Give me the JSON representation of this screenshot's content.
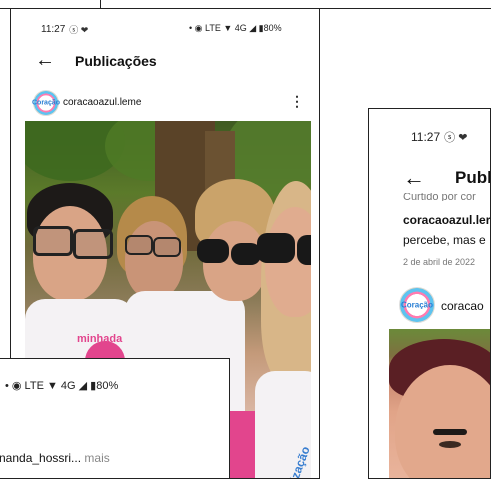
{
  "main": {
    "status": {
      "time": "11:27",
      "icons": "ⓢ ❤",
      "right": "• ◉ LTE ▼ 4G ◢ ▮80%"
    },
    "title": "Publicações",
    "account": "coracaoazul.leme",
    "avatar_text": "Coração",
    "shirt_text_1": "minhada de",
    "shirt_text_2": "ização d"
  },
  "right": {
    "status": {
      "time": "11:27",
      "icons": "ⓢ ❤"
    },
    "title": "Publica",
    "caption_cut": "Curtido por cor",
    "caption_user": "coracaoazul.ler",
    "caption_tail": "percebe, mas e",
    "date": "2 de abril de 2022",
    "account": "coracao",
    "avatar_text": "Coração"
  },
  "bottom": {
    "status_right": "• ◉ LTE ▼ 4G ◢ ▮80%",
    "text_user": "nanda_hossri...",
    "text_more": "mais"
  }
}
